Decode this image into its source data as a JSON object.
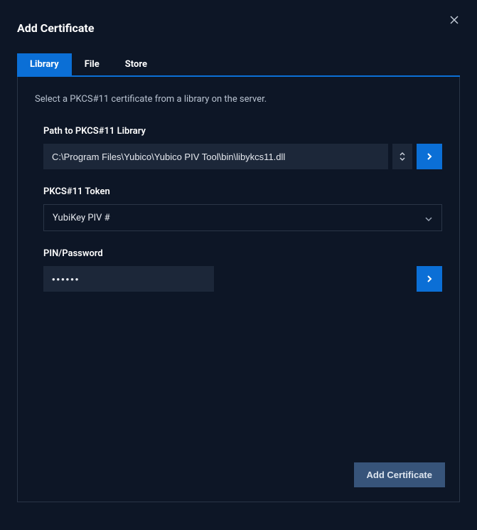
{
  "header": {
    "title": "Add Certificate"
  },
  "tabs": {
    "library": "Library",
    "file": "File",
    "store": "Store"
  },
  "panel": {
    "instruction": "Select a PKCS#11 certificate from a library on the server.",
    "path": {
      "label": "Path to PKCS#11 Library",
      "value": "C:\\Program Files\\Yubico\\Yubico PIV Tool\\bin\\libykcs11.dll"
    },
    "token": {
      "label": "PKCS#11 Token",
      "value": "YubiKey PIV #"
    },
    "pin": {
      "label": "PIN/Password",
      "value": "••••••"
    }
  },
  "footer": {
    "add_label": "Add Certificate"
  }
}
